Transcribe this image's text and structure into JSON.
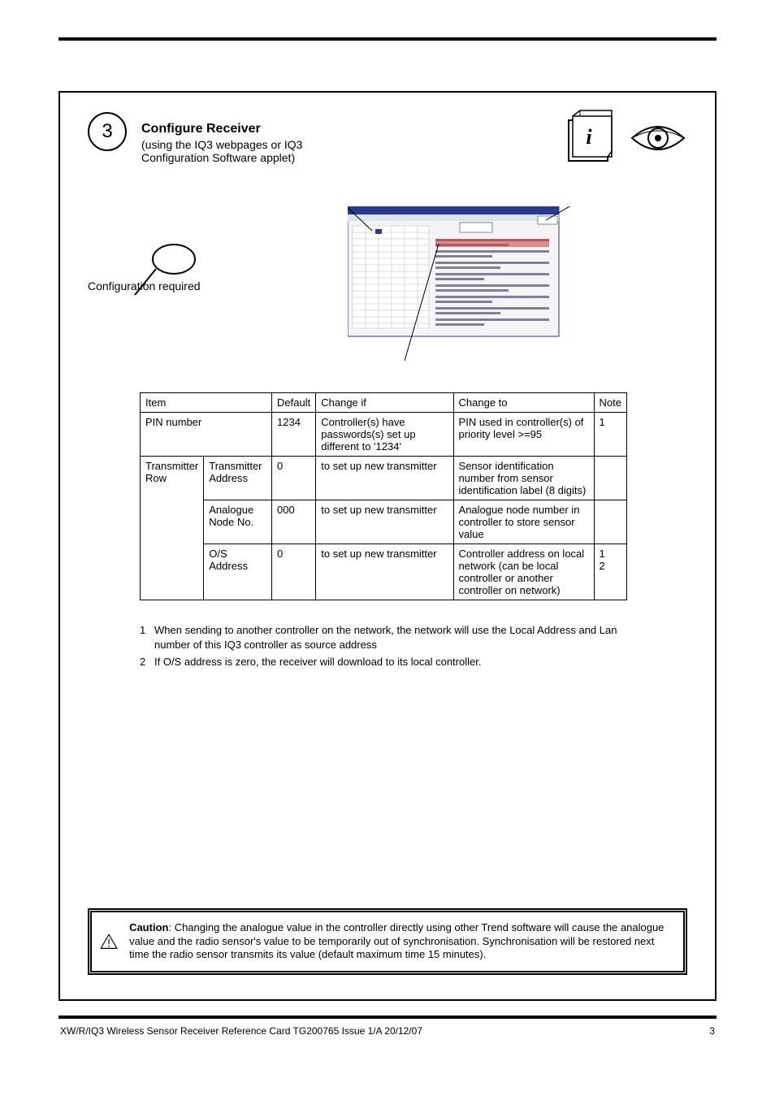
{
  "step": {
    "number": "3",
    "title": "Configure Receiver",
    "subtitle": "(using the IQ3 webpages or IQ3 Configuration Software applet)"
  },
  "config": {
    "title": "Configuration required",
    "headers": {
      "item": "Item",
      "default": "Default",
      "change_if": "Change if",
      "change_to": "Change to",
      "note": "Note"
    },
    "rows": [
      {
        "item_a": "PIN number",
        "item_b": "",
        "default": "1234",
        "change_if": "Controller(s) have passwords(s) set up different to '1234'",
        "change_to": "PIN used in controller(s) of priority level >=95",
        "note": "1"
      },
      {
        "item_a": "Transmitter Row",
        "item_b": "Transmitter Address",
        "default": "0",
        "change_if": "to set up new transmitter",
        "change_to": "Sensor identification number from sensor identification label (8 digits)",
        "note": ""
      },
      {
        "item_a": "",
        "item_b": "Analogue Node No.",
        "default": "000",
        "change_if": "to set up new transmitter",
        "change_to": "Analogue node number in controller to store sensor value",
        "note": ""
      },
      {
        "item_a": "",
        "item_b": "O/S Address",
        "default": "0",
        "change_if": "to set up new transmitter",
        "change_to": "Controller address on local network (can be local controller or another controller on network)",
        "note": "1\n2"
      }
    ]
  },
  "notes": {
    "n1": "When sending to another controller on the network, the network will use the Local Address and Lan number of this IQ3 controller as source address",
    "n2": "If O/S address is zero, the receiver will download to its local controller."
  },
  "caution": {
    "head": "Caution",
    "body": "Changing the analogue value in the controller directly using other Trend software will cause the analogue value and the radio sensor's value to be temporarily out of synchronisation. Synchronisation will be restored next time the radio sensor transmits its value (default maximum time 15 minutes)."
  },
  "footer": {
    "left": "XW/R/IQ3 Wireless Sensor Receiver Reference Card TG200765 Issue 1/A 20/12/07",
    "right": "3"
  }
}
